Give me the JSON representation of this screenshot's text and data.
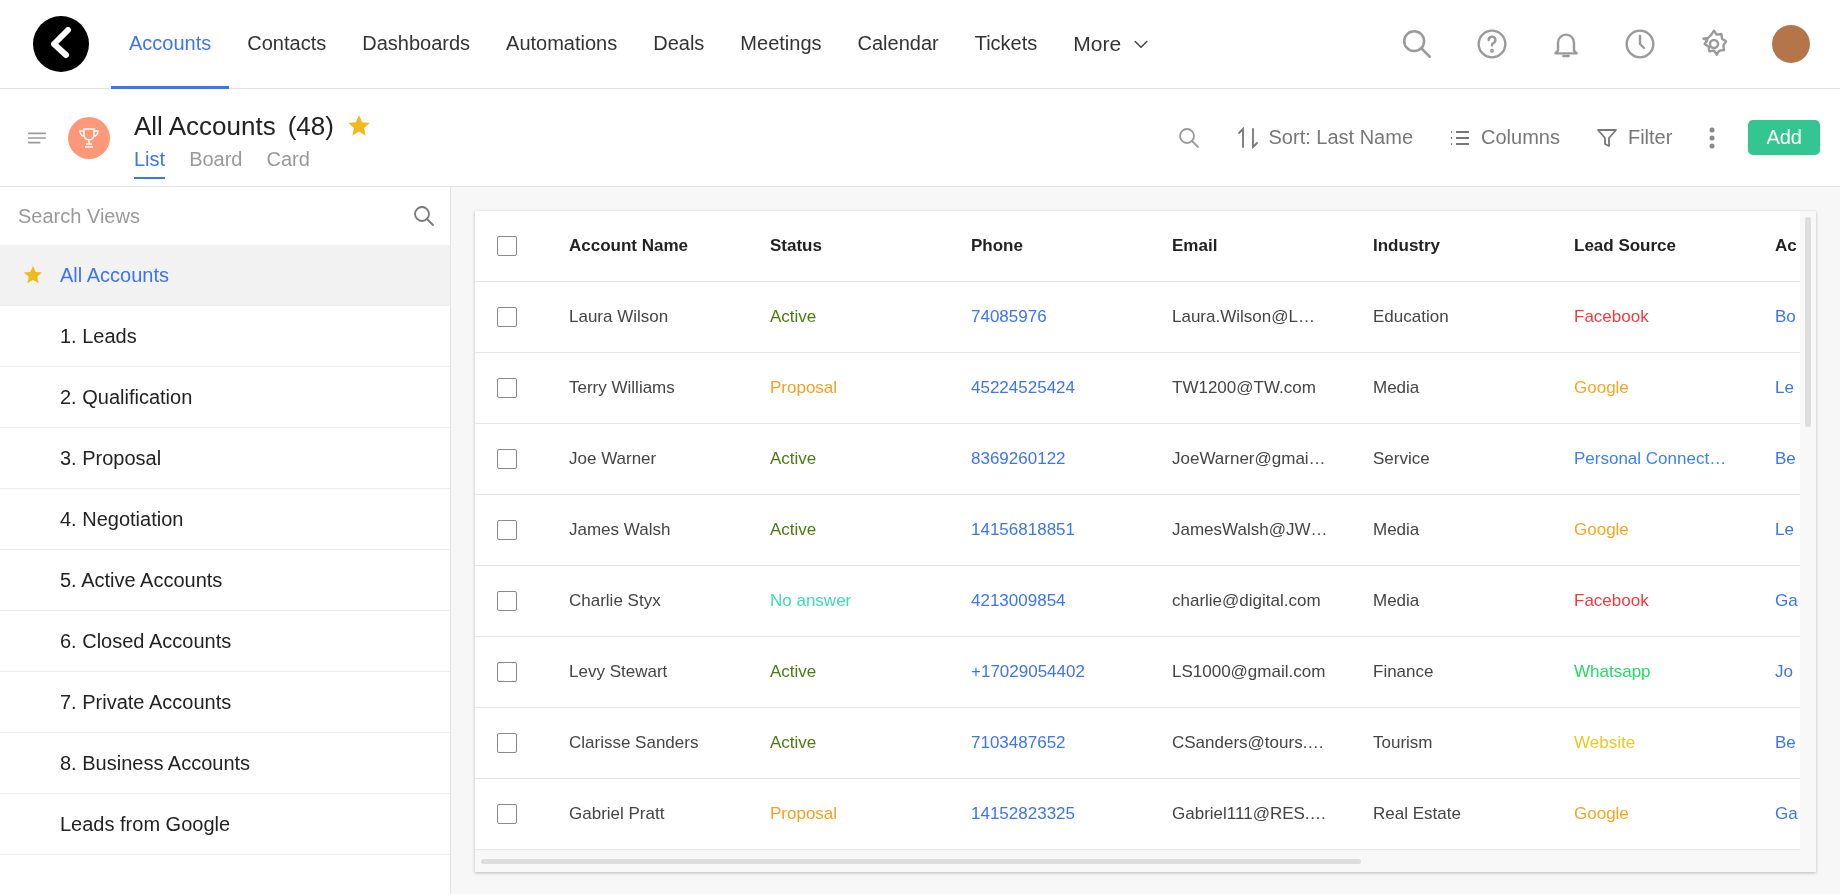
{
  "top_nav": {
    "items": [
      {
        "label": "Accounts",
        "selected": true
      },
      {
        "label": "Contacts",
        "selected": false
      },
      {
        "label": "Dashboards",
        "selected": false
      },
      {
        "label": "Automations",
        "selected": false
      },
      {
        "label": "Deals",
        "selected": false
      },
      {
        "label": "Meetings",
        "selected": false
      },
      {
        "label": "Calendar",
        "selected": false
      },
      {
        "label": "Tickets",
        "selected": false
      }
    ],
    "more": "More"
  },
  "header": {
    "title": "All Accounts",
    "count": "(48)",
    "starred": true,
    "view_tabs": [
      {
        "label": "List",
        "selected": true
      },
      {
        "label": "Board",
        "selected": false
      },
      {
        "label": "Card",
        "selected": false
      }
    ],
    "sort": "Sort: Last Name",
    "columns": "Columns",
    "filter": "Filter",
    "add": "Add"
  },
  "sidebar": {
    "search": {
      "placeholder": "Search Views"
    },
    "items": [
      {
        "label": "All Accounts",
        "selected": true,
        "starred": true
      },
      {
        "label": "1. Leads",
        "selected": false,
        "starred": false
      },
      {
        "label": "2. Qualification",
        "selected": false,
        "starred": false
      },
      {
        "label": "3. Proposal",
        "selected": false,
        "starred": false
      },
      {
        "label": "4. Negotiation",
        "selected": false,
        "starred": false
      },
      {
        "label": "5. Active Accounts",
        "selected": false,
        "starred": false
      },
      {
        "label": "6. Closed Accounts",
        "selected": false,
        "starred": false
      },
      {
        "label": "7. Private Accounts",
        "selected": false,
        "starred": false
      },
      {
        "label": "8. Business Accounts",
        "selected": false,
        "starred": false
      },
      {
        "label": "Leads from Google",
        "selected": false,
        "starred": false
      }
    ]
  },
  "table": {
    "all_checked": false,
    "columns": [
      "Account Name",
      "Status",
      "Phone",
      "Email",
      "Industry",
      "Lead Source",
      "Ac"
    ],
    "rows": [
      {
        "checked": false,
        "account_name": "Laura Wilson",
        "status": {
          "text": "Active",
          "color": "#4b7a12"
        },
        "phone": "74085976",
        "email": "Laura.Wilson@L…",
        "industry": "Education",
        "lead_source": {
          "text": "Facebook",
          "color": "#f23c3c"
        },
        "column_7": "Bo"
      },
      {
        "checked": false,
        "account_name": "Terry Williams",
        "status": {
          "text": "Proposal",
          "color": "#f5a020"
        },
        "phone": "45224525424",
        "email": "TW1200@TW.com",
        "industry": "Media",
        "lead_source": {
          "text": "Google",
          "color": "#f5a623"
        },
        "column_7": "Le"
      },
      {
        "checked": false,
        "account_name": "Joe Warner",
        "status": {
          "text": "Active",
          "color": "#4b7a12"
        },
        "phone": "8369260122",
        "email": "JoeWarner@gmai…",
        "industry": "Service",
        "lead_source": {
          "text": "Personal Connect…",
          "color": "#3b82f0"
        },
        "column_7": "Be"
      },
      {
        "checked": false,
        "account_name": "James Walsh",
        "status": {
          "text": "Active",
          "color": "#4b7a12"
        },
        "phone": "14156818851",
        "email": "JamesWalsh@JW…",
        "industry": "Media",
        "lead_source": {
          "text": "Google",
          "color": "#f5a623"
        },
        "column_7": "Le"
      },
      {
        "checked": false,
        "account_name": "Charlie Styx",
        "status": {
          "text": "No answer",
          "color": "#3ddbb5"
        },
        "phone": "4213009854",
        "email": "charlie@digital.com",
        "industry": "Media",
        "lead_source": {
          "text": "Facebook",
          "color": "#f23c3c"
        },
        "column_7": "Ga"
      },
      {
        "checked": false,
        "account_name": "Levy Stewart",
        "status": {
          "text": "Active",
          "color": "#4b7a12"
        },
        "phone": "+17029054402",
        "email": "LS1000@gmail.com",
        "industry": "Finance",
        "lead_source": {
          "text": "Whatsapp",
          "color": "#22dd66"
        },
        "column_7": "Jo"
      },
      {
        "checked": false,
        "account_name": "Clarisse Sanders",
        "status": {
          "text": "Active",
          "color": "#4b7a12"
        },
        "phone": "7103487652",
        "email": "CSanders@tours.…",
        "industry": "Tourism",
        "lead_source": {
          "text": "Website",
          "color": "#eac823"
        },
        "column_7": "Be"
      },
      {
        "checked": false,
        "account_name": "Gabriel Pratt",
        "status": {
          "text": "Proposal",
          "color": "#f5a020"
        },
        "phone": "14152823325",
        "email": "Gabriel111@RES.…",
        "industry": "Real Estate",
        "lead_source": {
          "text": "Google",
          "color": "#f5a623"
        },
        "column_7": "Ga"
      }
    ]
  }
}
